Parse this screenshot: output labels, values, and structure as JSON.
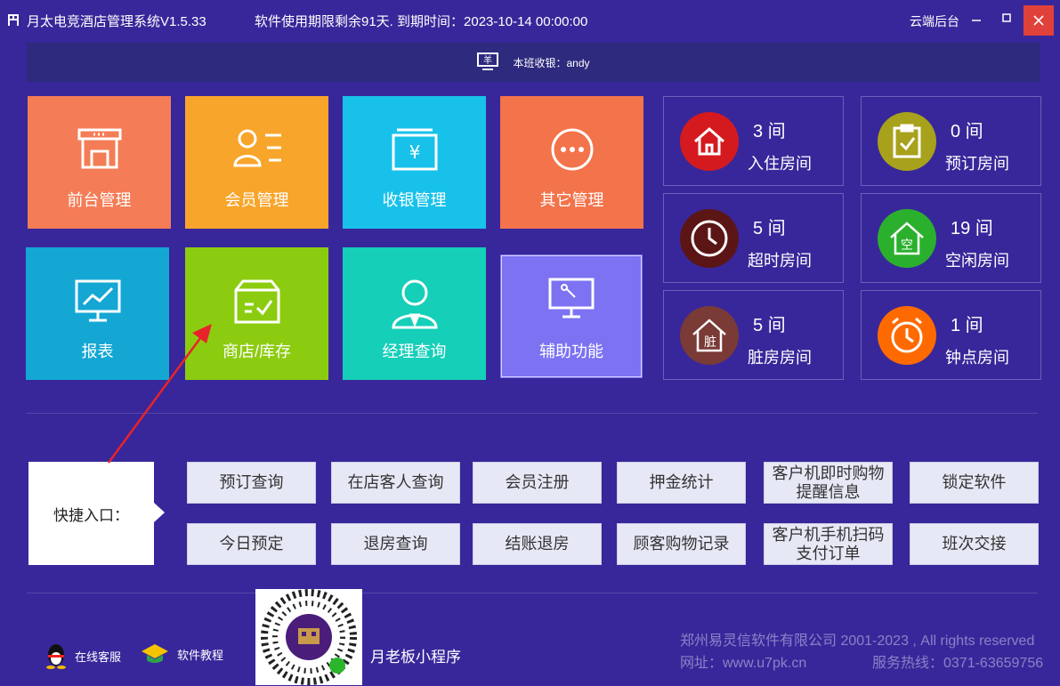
{
  "window": {
    "title": "月太电竞酒店管理系统V1.5.33",
    "expiry": "软件使用期限剩余91天. 到期时间：2023-10-14 00:00:00",
    "cloud_label": "云端后台"
  },
  "cashier": {
    "label": "本班收银：andy"
  },
  "tiles": [
    {
      "label": "前台管理",
      "color": "#f47c56",
      "icon": "storefront-icon"
    },
    {
      "label": "会员管理",
      "color": "#f8a52b",
      "icon": "member-card-icon"
    },
    {
      "label": "收银管理",
      "color": "#18c1ea",
      "icon": "cashier-yuan-icon"
    },
    {
      "label": "其它管理",
      "color": "#f3734b",
      "icon": "more-icon"
    },
    {
      "label": "报表",
      "color": "#14a7d4",
      "icon": "report-chart-icon"
    },
    {
      "label": "商店/库存",
      "color": "#8ccc10",
      "icon": "inventory-box-icon"
    },
    {
      "label": "经理查询",
      "color": "#15cfb8",
      "icon": "manager-icon"
    },
    {
      "label": "辅助功能",
      "color": "#7c72f2",
      "icon": "monitor-wrench-icon"
    }
  ],
  "stats": [
    {
      "count": "3 间",
      "name": "入住房间",
      "color": "#d51a1f",
      "icon": "house-icon"
    },
    {
      "count": "0 间",
      "name": "预订房间",
      "color": "#a8a11b",
      "icon": "clipboard-check-icon"
    },
    {
      "count": "5 间",
      "name": "超时房间",
      "color": "#5c1515",
      "icon": "clock-icon"
    },
    {
      "count": "19 间",
      "name": "空闲房间",
      "color": "#2bb02e",
      "icon": "empty-house-icon"
    },
    {
      "count": "5 间",
      "name": "脏房房间",
      "color": "#7a3a36",
      "icon": "dirty-house-icon"
    },
    {
      "count": "1 间",
      "name": "钟点房间",
      "color": "#ff6a00",
      "icon": "alarm-clock-icon"
    }
  ],
  "quick": {
    "label": "快捷入口：",
    "row1": [
      "预订查询",
      "在店客人查询",
      "会员注册",
      "押金统计",
      "客户机即时购物\n提醒信息",
      "锁定软件"
    ],
    "row2": [
      "今日预定",
      "退房查询",
      "结账退房",
      "顾客购物记录",
      "客户机手机扫码\n支付订单",
      "班次交接"
    ]
  },
  "bottom": {
    "online_service": "在线客服",
    "tutorial": "软件教程",
    "mini_program": "月老板小程序",
    "copyright": "郑州易灵信软件有限公司 2001-2023 , All rights reserved",
    "website": "网址：www.u7pk.cn",
    "hotline": "服务热线：0371-63659756"
  }
}
